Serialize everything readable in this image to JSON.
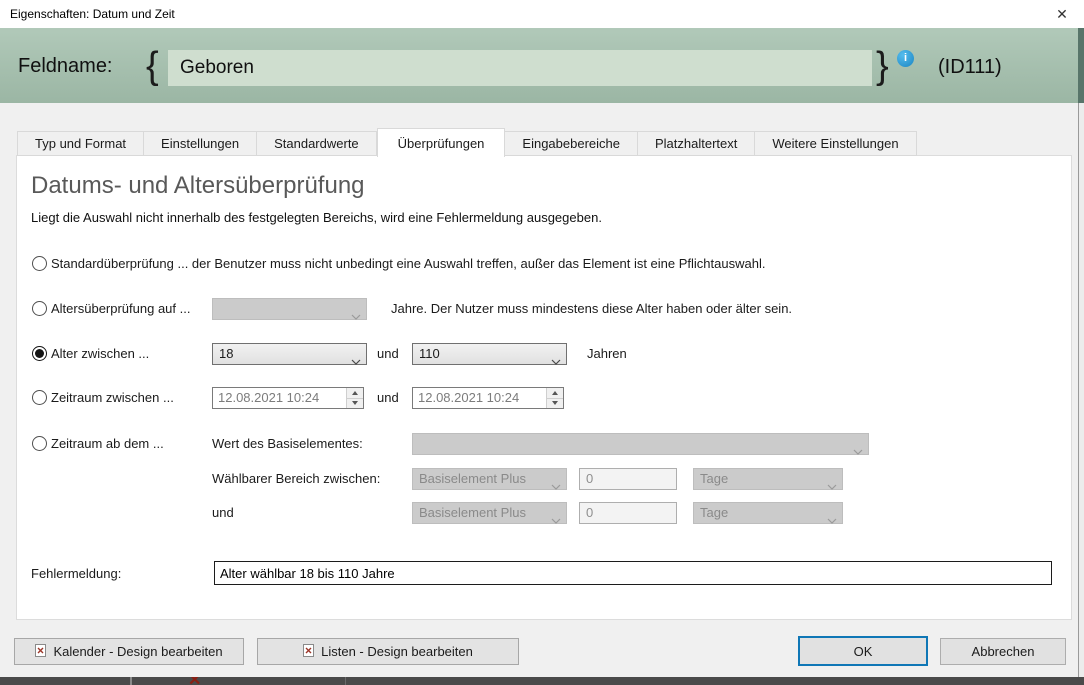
{
  "window": {
    "title": "Eigenschaften: Datum und Zeit",
    "close_glyph": "✕"
  },
  "header": {
    "field_label": "Feldname:",
    "open_brace": "{",
    "field_value": "Geboren",
    "close_brace": "}",
    "info_glyph": "i",
    "field_id": "(ID111)"
  },
  "tabs": [
    {
      "label": "Typ und Format"
    },
    {
      "label": "Einstellungen"
    },
    {
      "label": "Standardwerte"
    },
    {
      "label": "Überprüfungen"
    },
    {
      "label": "Eingabebereiche"
    },
    {
      "label": "Platzhaltertext"
    },
    {
      "label": "Weitere Einstellungen"
    }
  ],
  "content": {
    "heading": "Datums- und Altersüberprüfung",
    "description": "Liegt die Auswahl nicht innerhalb des festgelegten Bereichs, wird eine Fehlermeldung ausgegeben.",
    "standard_option": {
      "label": "Standardüberprüfung ... der Benutzer muss nicht unbedingt eine Auswahl treffen, außer das Element ist eine Pflichtauswahl."
    },
    "age_min_option": {
      "label": "Altersüberprüfung auf ...",
      "value": "",
      "suffix": "Jahre. Der Nutzer muss mindestens diese Alter haben oder älter sein."
    },
    "age_between_option": {
      "label": "Alter zwischen ...",
      "from": "18",
      "conjunction": "und",
      "to": "110",
      "suffix": "Jahren"
    },
    "period_between_option": {
      "label": "Zeitraum zwischen ...",
      "from": "12.08.2021 10:24",
      "conjunction": "und",
      "to": "12.08.2021 10:24"
    },
    "period_from_option": {
      "label": "Zeitraum ab dem ...",
      "base_label": "Wert des Basiselementes:",
      "base_value": "",
      "range_label": "Wählbarer Bereich zwischen:",
      "from_mode": "Basiselement Plus",
      "from_value": "0",
      "from_unit": "Tage",
      "conjunction": "und",
      "to_mode": "Basiselement Plus",
      "to_value": "0",
      "to_unit": "Tage"
    },
    "error_row": {
      "label": "Fehlermeldung:",
      "value": "Alter wählbar 18 bis 110 Jahre"
    }
  },
  "footer": {
    "calendar_button": "Kalender - Design bearbeiten",
    "lists_button": "Listen - Design bearbeiten",
    "ok_button": "OK",
    "cancel_button": "Abbrechen"
  },
  "colors": {
    "header_bg": "#a7c0af",
    "header_field_bg": "#cfdecf",
    "accent_blue": "#0f77b6",
    "info_icon_blue": "#2196d3"
  }
}
